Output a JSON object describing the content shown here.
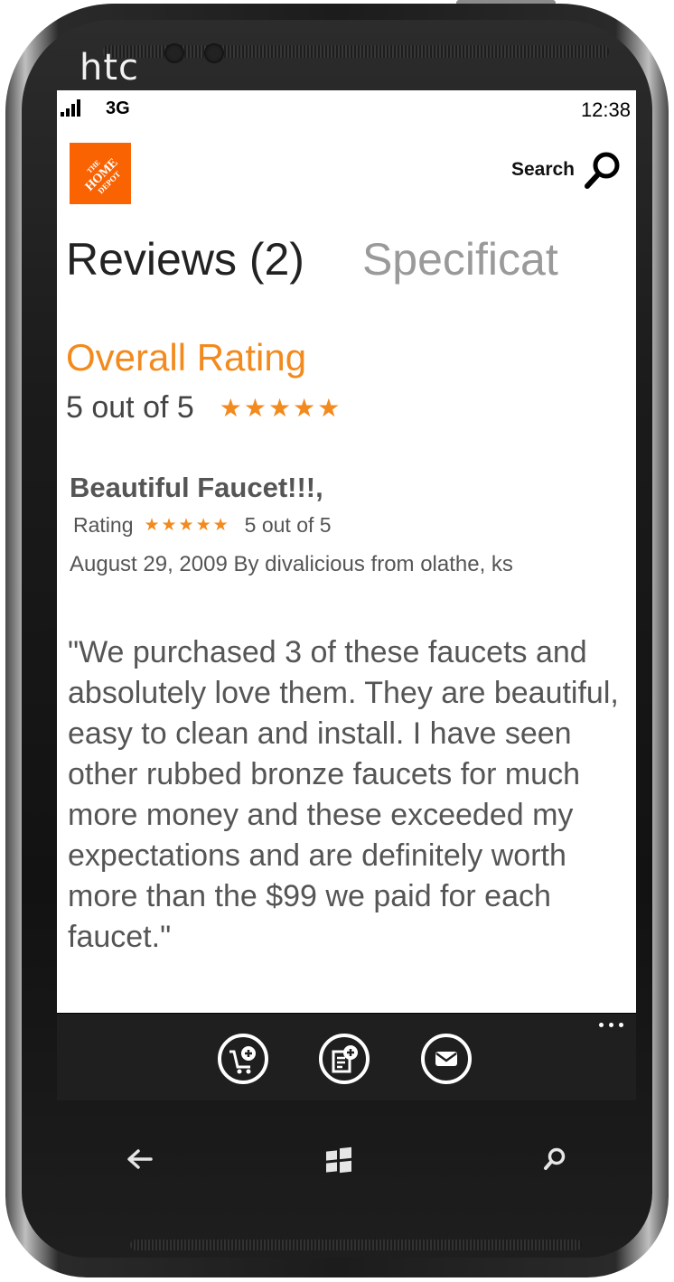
{
  "device": {
    "brand": "htc"
  },
  "status_bar": {
    "network": "3G",
    "time": "12:38"
  },
  "header": {
    "logo_alt": "The Home Depot",
    "search_label": "Search"
  },
  "pivot": {
    "active": "Reviews (2)",
    "inactive": "Specificat"
  },
  "overall": {
    "title": "Overall Rating",
    "score_text": "5 out of 5",
    "stars": 5,
    "stars_glyph": "★★★★★"
  },
  "review": {
    "title": "Beautiful Faucet!!!,",
    "rating_label": "Rating",
    "stars_glyph": "★★★★★",
    "rating_text": "5 out of 5",
    "meta": "August 29, 2009 By divalicious from olathe, ks",
    "body": "\"We purchased 3 of these faucets and absolutely love them. They are beautiful, easy to clean and install. I have seen other rubbed bronze faucets for much more money and these exceeded my expectations and are definitely worth more than the $99 we paid for each faucet.\""
  },
  "app_bar": {
    "buttons": [
      "add-to-cart",
      "add-to-list",
      "email"
    ],
    "more": "..."
  },
  "colors": {
    "accent": "#f28a1e",
    "logo": "#f96302",
    "appbar": "#1f1f1f"
  }
}
